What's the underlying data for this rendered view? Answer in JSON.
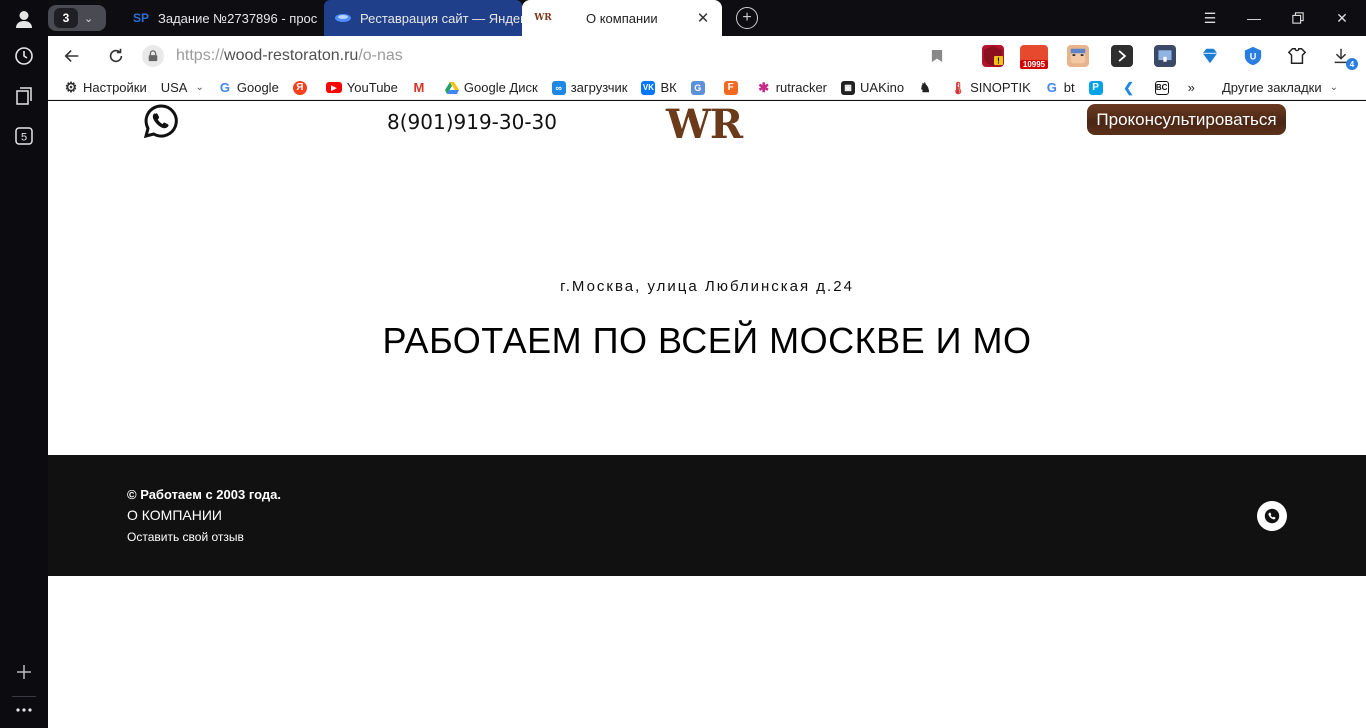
{
  "browser": {
    "tab_counter": "3",
    "tabs": [
      {
        "favicon": "SP",
        "title": "Задание №2737896 - прос"
      },
      {
        "favicon": "disk-icon",
        "title": "Реставрация сайт — Яндек"
      },
      {
        "favicon": "WR",
        "title": "О компании"
      }
    ],
    "address": {
      "scheme": "https://",
      "host": "wood-restoraton.ru",
      "path": "/o-nas"
    },
    "downloads_badge": "4",
    "ext_badge": "10995"
  },
  "bookmarks": [
    {
      "label": "Настройки",
      "icon": "gear-icon"
    },
    {
      "label": "USA",
      "icon": "dropdown"
    },
    {
      "label": "Google",
      "icon": "google-icon"
    },
    {
      "label": "",
      "icon": "yandex-icon"
    },
    {
      "label": "YouTube",
      "icon": "youtube-icon"
    },
    {
      "label": "",
      "icon": "gmail-icon"
    },
    {
      "label": "Google Диск",
      "icon": "drive-icon"
    },
    {
      "label": "загрузчик",
      "icon": "loop-icon"
    },
    {
      "label": "ВК",
      "icon": "vk-icon"
    },
    {
      "label": "",
      "icon": "translate-icon"
    },
    {
      "label": "",
      "icon": "f-icon"
    },
    {
      "label": "rutracker",
      "icon": "rutracker-icon"
    },
    {
      "label": "UAKino",
      "icon": "film-icon"
    },
    {
      "label": "",
      "icon": "chess-icon"
    },
    {
      "label": "SINOPTIK",
      "icon": "thermometer-icon"
    },
    {
      "label": "bt",
      "icon": "google-icon"
    },
    {
      "label": "",
      "icon": "p-icon"
    },
    {
      "label": "",
      "icon": "k-icon"
    },
    {
      "label": "",
      "icon": "bc-icon"
    }
  ],
  "bookmarks_more": "»",
  "other_bookmarks": "Другие закладки",
  "page": {
    "phone": "8(901)919-30-30",
    "logo": "WR",
    "consult_button": "Проконсультироваться",
    "address_line": "г.Москва, улица Люблинская д.24",
    "headline": "РАБОТАЕМ ПО ВСЕЙ МОСКВЕ И МО",
    "footer": {
      "copyright": "© Работаем с 2003 года.",
      "about": "О КОМПАНИИ",
      "review": "Оставить свой отзыв"
    }
  }
}
